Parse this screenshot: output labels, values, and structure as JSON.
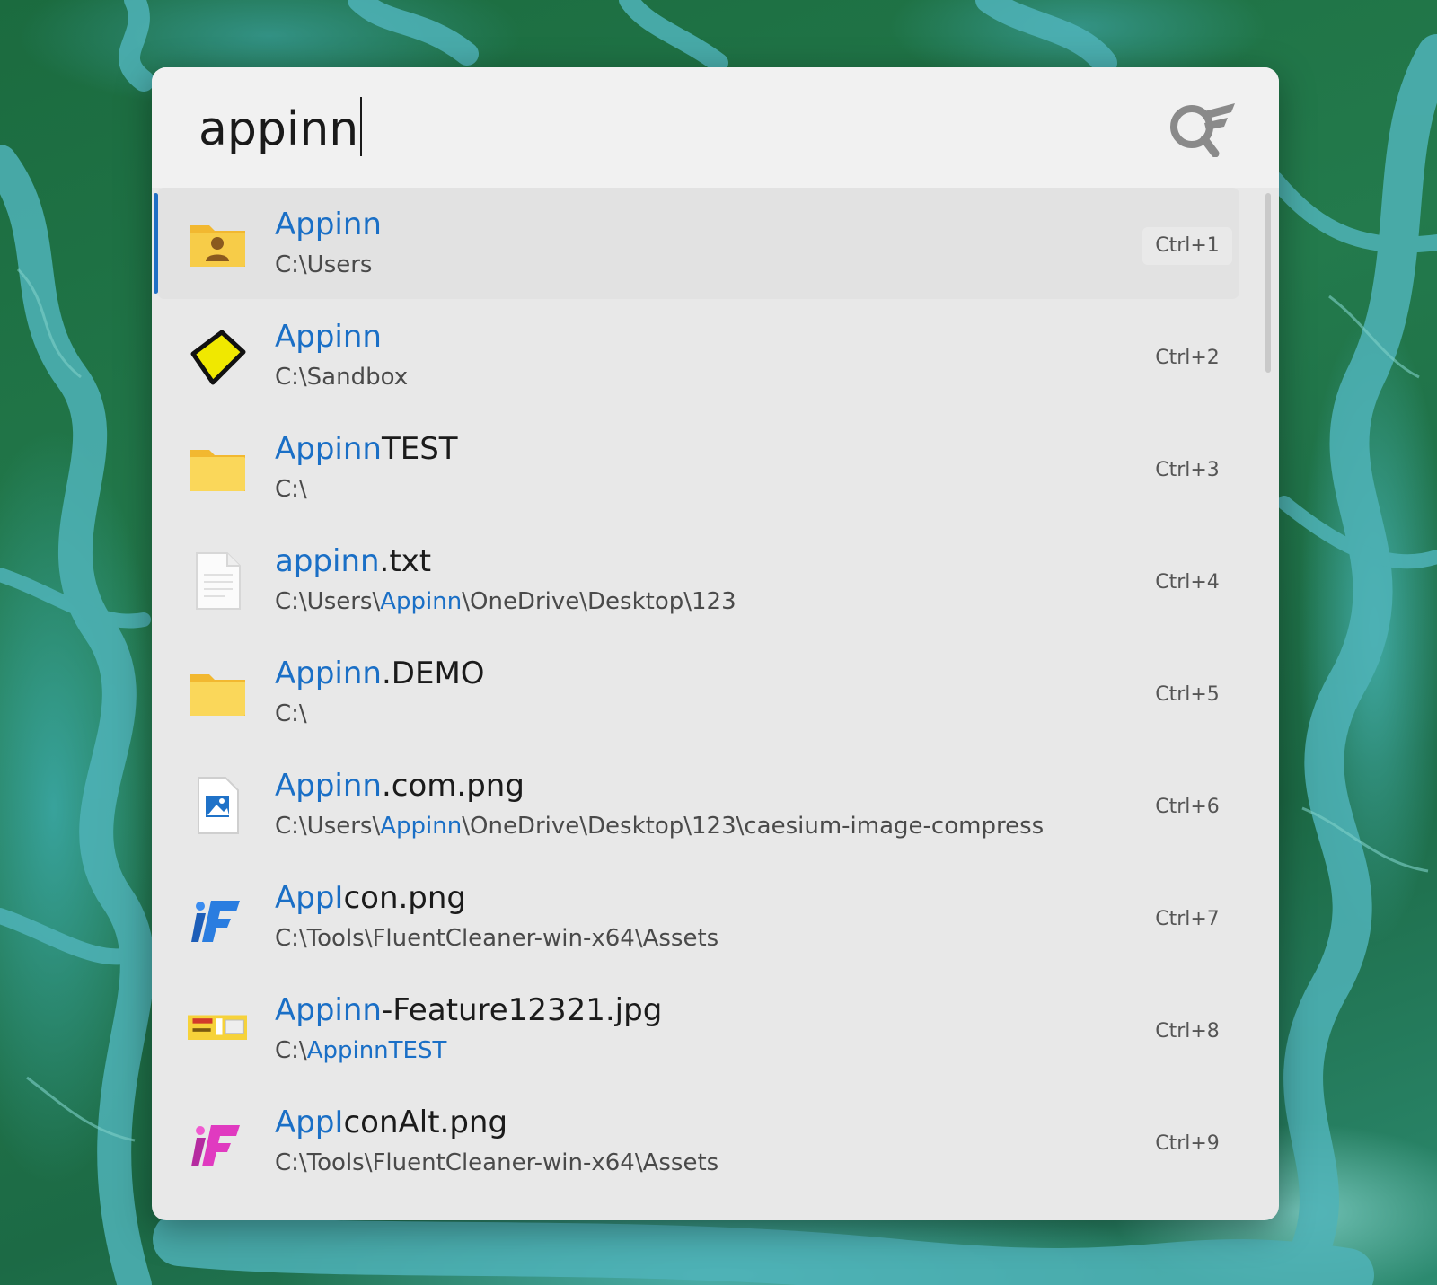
{
  "search": {
    "query": "appinn"
  },
  "results": [
    {
      "icon": "user-folder-icon",
      "title_match": "Appinn",
      "title_rest": "",
      "path_before": "C:\\Users",
      "path_match": "",
      "path_after": "",
      "shortcut": "Ctrl+1",
      "selected": true
    },
    {
      "icon": "sandbox-diamond-icon",
      "title_match": "Appinn",
      "title_rest": "",
      "path_before": "C:\\Sandbox",
      "path_match": "",
      "path_after": "",
      "shortcut": "Ctrl+2",
      "selected": false
    },
    {
      "icon": "folder-icon",
      "title_match": "Appinn",
      "title_rest": "TEST",
      "path_before": "C:\\",
      "path_match": "",
      "path_after": "",
      "shortcut": "Ctrl+3",
      "selected": false
    },
    {
      "icon": "text-file-icon",
      "title_match": "appinn",
      "title_rest": ".txt",
      "path_before": "C:\\Users\\",
      "path_match": "Appinn",
      "path_after": "\\OneDrive\\Desktop\\123",
      "shortcut": "Ctrl+4",
      "selected": false
    },
    {
      "icon": "folder-icon",
      "title_match": "Appinn",
      "title_rest": ".DEMO",
      "path_before": "C:\\",
      "path_match": "",
      "path_after": "",
      "shortcut": "Ctrl+5",
      "selected": false
    },
    {
      "icon": "image-file-icon",
      "title_match": "Appinn",
      "title_rest": ".com.png",
      "path_before": "C:\\Users\\",
      "path_match": "Appinn",
      "path_after": "\\OneDrive\\Desktop\\123\\caesium-image-compress",
      "shortcut": "Ctrl+6",
      "selected": false
    },
    {
      "icon": "fluentcleaner-blue-icon",
      "title_match": "AppI",
      "title_rest": "con.png",
      "path_before": "C:\\Tools\\FluentCleaner-win-x64\\Assets",
      "path_match": "",
      "path_after": "",
      "shortcut": "Ctrl+7",
      "selected": false
    },
    {
      "icon": "jpg-thumbnail-icon",
      "title_match": "Appinn",
      "title_rest": "-Feature12321.jpg",
      "path_before": "C:\\",
      "path_match": "AppinnTEST",
      "path_after": "",
      "shortcut": "Ctrl+8",
      "selected": false
    },
    {
      "icon": "fluentcleaner-pink-icon",
      "title_match": "AppI",
      "title_rest": "conAlt.png",
      "path_before": "C:\\Tools\\FluentCleaner-win-x64\\Assets",
      "path_match": "",
      "path_after": "",
      "shortcut": "Ctrl+9",
      "selected": false
    }
  ],
  "colors": {
    "highlight": "#1a6fc6",
    "selection_indicator": "#1f6fc4"
  }
}
